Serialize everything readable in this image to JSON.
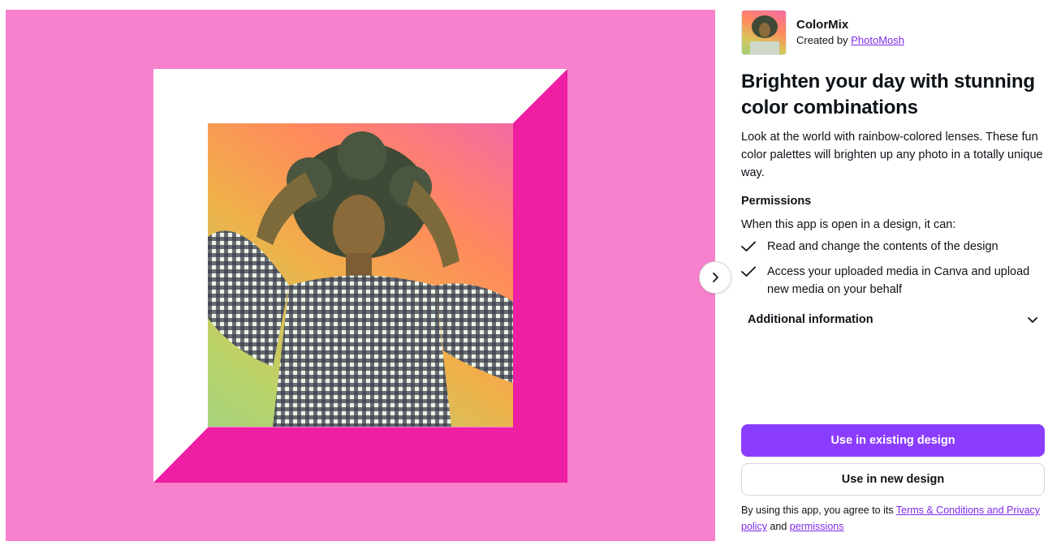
{
  "preview": {
    "background_color": "#f781cc",
    "frame_color": "#ee1fa2",
    "frame_light": "#ffffff",
    "next_icon": "chevron-right-icon"
  },
  "app": {
    "name": "ColorMix",
    "created_by_prefix": "Created by",
    "creator": "PhotoMosh"
  },
  "headline": "Brighten your day with stunning color combinations",
  "description": "Look at the world with rainbow-colored lenses. These fun color palettes will brighten up any photo in a totally unique way.",
  "permissions": {
    "title": "Permissions",
    "intro": "When this app is open in a design, it can:",
    "items": [
      "Read and change the contents of the design",
      "Access your uploaded media in Canva and upload new media on your behalf"
    ]
  },
  "additional_info": {
    "label": "Additional information",
    "icon": "chevron-down-icon"
  },
  "actions": {
    "primary": "Use in existing design",
    "secondary": "Use in new design",
    "primary_color": "#8b3dff"
  },
  "terms": {
    "prefix": "By using this app, you agree to its",
    "terms_link": "Terms & Conditions and Privacy policy",
    "conjunction": "and",
    "permissions_link": "permissions"
  }
}
